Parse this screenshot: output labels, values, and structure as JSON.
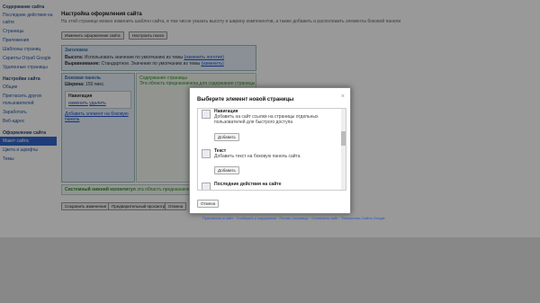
{
  "sidebar": {
    "section1": "Содержание сайта",
    "items1": [
      "Последние действия на сайте",
      "Страницы",
      "Приложения",
      "Шаблоны страниц",
      "Скрипты Отраб Google",
      "Удаленные страницы"
    ],
    "section2": "Настройки сайта",
    "items2": [
      "Общие",
      "Пригласить других пользователей",
      "Заработать",
      "Веб-адрес"
    ],
    "section3": "Оформление сайта",
    "items3": [
      "Макет сайта",
      "Цвета и шрифты",
      "Темы"
    ]
  },
  "main": {
    "title": "Настройка оформления сайта",
    "description": "На этой странице можно изменить шаблон сайта, в том числе указать высоту и ширину компонентов, а также добавить и расположить элементы боковой панели",
    "btn_edit": "Изменить оформление сайта",
    "btn_nav": "Настроить поиск",
    "header_label": "Заголовок",
    "height_label": "Высота:",
    "height_value": "Использовать значение по умолчанию из темы",
    "height_link": "(изменить логотип)",
    "align_label": "Выравнивание:",
    "align_value": "Стандартное. Значение по умолчанию из темы",
    "align_link": "(изменить)",
    "sidebar_label": "Боковая панель",
    "width_label": "Ширина:",
    "width_value": "150 пикс.",
    "nav_label": "Навигация",
    "nav_edit": "изменить",
    "nav_delete": "удалить",
    "add_sidebar": "Добавить элемент на боковую панель",
    "content_label": "Содержание страницы",
    "content_desc": "Эта область предназначена для содержания страницы",
    "footer_label": "Системный нижний колонтитул",
    "footer_desc": "эта область предназначена для сообщений",
    "btn_save": "Сохранить изменения",
    "btn_preview": "Предварительный просмотр",
    "btn_cancel": "Отмена"
  },
  "dialog": {
    "title": "Выберите элемент новой страницы",
    "close": "×",
    "items": [
      {
        "title": "Навигация",
        "desc": "Добавить на сайт ссылки на страницы отдельных пользователей для быстрого доступа",
        "btn": "Добавить"
      },
      {
        "title": "Текст",
        "desc": "Добавить текст на боковую панель сайта",
        "btn": "Добавить"
      },
      {
        "title": "Последние действия на сайте",
        "desc": "",
        "btn": ""
      }
    ],
    "cancel": "Отмена"
  },
  "page_footer": "Пригласить в сайт · Сообщить о нарушении · Печать страницы · Отключить сайт · Технологии Сайты Google"
}
